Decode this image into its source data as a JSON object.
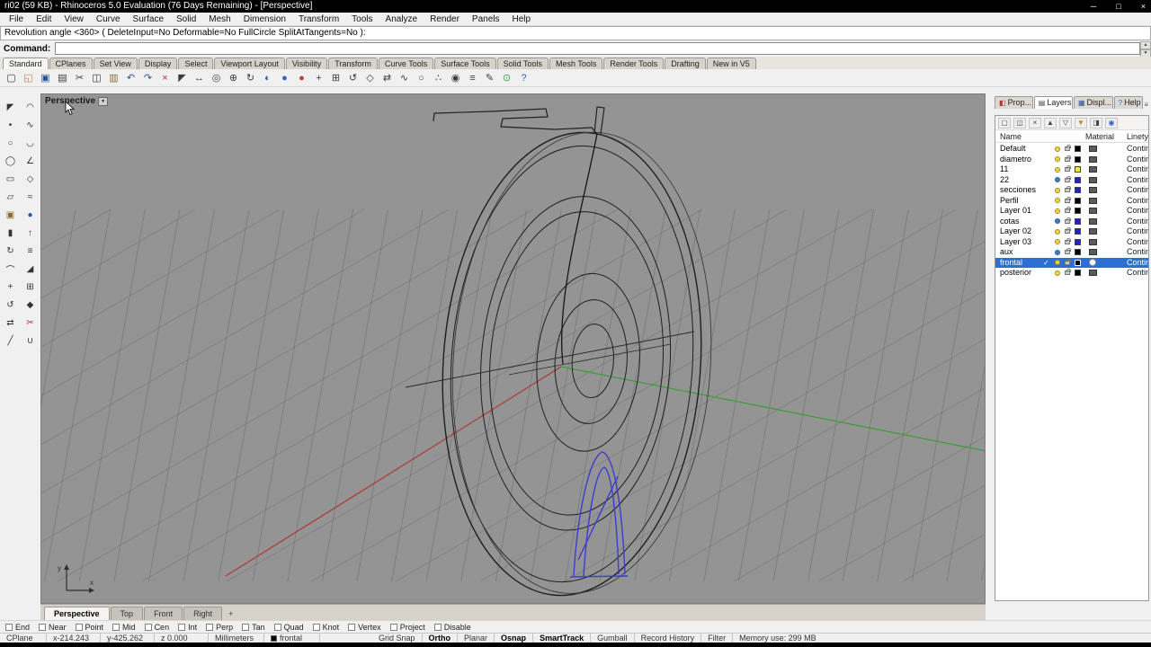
{
  "colors": {
    "selection_blue": "#2b6fd4",
    "axis_red": "#b03030",
    "axis_green": "#2f9e2f",
    "curve_blue": "#3b3bd1",
    "viewport_bg": "#949494"
  },
  "icons": {
    "check": "✓",
    "dropdown_arrow": "▼",
    "up_arrow": "▲",
    "down_arrow": "▼",
    "new_viewport_tab": "+",
    "panel_menu": "≡"
  },
  "window": {
    "title": "ri02 (59 KB) - Rhinoceros 5.0 Evaluation (76 Days Remaining) - [Perspective]",
    "minimize": "─",
    "maximize": "□",
    "close": "×"
  },
  "menu_items": [
    "File",
    "Edit",
    "View",
    "Curve",
    "Surface",
    "Solid",
    "Mesh",
    "Dimension",
    "Transform",
    "Tools",
    "Analyze",
    "Render",
    "Panels",
    "Help"
  ],
  "command": {
    "history": "Revolution angle <360> ( DeleteInput=No  Deformable=No  FullCircle  SplitAtTangents=No ):",
    "label": "Command:",
    "input_value": ""
  },
  "toolbar_tabs": [
    {
      "label": "Standard",
      "active": true
    },
    {
      "label": "CPlanes"
    },
    {
      "label": "Set View"
    },
    {
      "label": "Display"
    },
    {
      "label": "Select"
    },
    {
      "label": "Viewport Layout"
    },
    {
      "label": "Visibility"
    },
    {
      "label": "Transform"
    },
    {
      "label": "Curve Tools"
    },
    {
      "label": "Surface Tools"
    },
    {
      "label": "Solid Tools"
    },
    {
      "label": "Mesh Tools"
    },
    {
      "label": "Render Tools"
    },
    {
      "label": "Drafting"
    },
    {
      "label": "New in V5"
    }
  ],
  "toolbar_icons": [
    {
      "name": "new-file-icon",
      "glyph": "▢",
      "color": "#3c3c3c"
    },
    {
      "name": "open-file-icon",
      "glyph": "◱",
      "color": "#c08a1a"
    },
    {
      "name": "save-icon",
      "glyph": "▣",
      "color": "#2f5496"
    },
    {
      "name": "print-icon",
      "glyph": "▤",
      "color": "#3c3c3c"
    },
    {
      "name": "cut-icon",
      "glyph": "✂",
      "color": "#3c3c3c"
    },
    {
      "name": "copy-icon",
      "glyph": "◫",
      "color": "#3c3c3c"
    },
    {
      "name": "paste-icon",
      "glyph": "▥",
      "color": "#8a6b2c"
    },
    {
      "name": "undo-icon",
      "glyph": "↶",
      "color": "#2f5496"
    },
    {
      "name": "redo-icon",
      "glyph": "↷",
      "color": "#2f5496"
    },
    {
      "name": "delete-icon",
      "glyph": "×",
      "color": "#b03030"
    },
    {
      "name": "select-icon",
      "glyph": "◤",
      "color": "#3c3c3c"
    },
    {
      "name": "pan-view-icon",
      "glyph": "↔",
      "color": "#3c3c3c"
    },
    {
      "name": "zoom-window-icon",
      "glyph": "◎",
      "color": "#3c3c3c"
    },
    {
      "name": "zoom-extents-icon",
      "glyph": "⊕",
      "color": "#3c3c3c"
    },
    {
      "name": "rotate-view-icon",
      "glyph": "↻",
      "color": "#3c3c3c"
    },
    {
      "name": "shaded-view-icon",
      "glyph": "◐",
      "color": "#2f5496"
    },
    {
      "name": "render-icon",
      "glyph": "●",
      "color": "#2e62c9"
    },
    {
      "name": "record-history-icon",
      "glyph": "●",
      "color": "#c23b2e"
    },
    {
      "name": "move-icon",
      "glyph": "+",
      "color": "#3c3c3c"
    },
    {
      "name": "copy-object-icon",
      "glyph": "⊞",
      "color": "#3c3c3c"
    },
    {
      "name": "rotate-icon",
      "glyph": "↺",
      "color": "#3c3c3c"
    },
    {
      "name": "scale-icon",
      "glyph": "◇",
      "color": "#3c3c3c"
    },
    {
      "name": "mirror-icon",
      "glyph": "⇄",
      "color": "#3c3c3c"
    },
    {
      "name": "curve-tools-icon",
      "glyph": "∿",
      "color": "#3c3c3c"
    },
    {
      "name": "circle-icon",
      "glyph": "○",
      "color": "#3c3c3c"
    },
    {
      "name": "control-points-icon",
      "glyph": "∴",
      "color": "#3c3c3c"
    },
    {
      "name": "object-snap-icon",
      "glyph": "◉",
      "color": "#3c3c3c"
    },
    {
      "name": "layers-icon",
      "glyph": "≡",
      "color": "#3c3c3c"
    },
    {
      "name": "properties-icon",
      "glyph": "✎",
      "color": "#3c3c3c"
    },
    {
      "name": "gumball-icon",
      "glyph": "⊙",
      "color": "#2e9e4f"
    },
    {
      "name": "help-icon",
      "glyph": "?",
      "color": "#2e62c9"
    }
  ],
  "sidebar_tools": [
    {
      "name": "select-tool-icon",
      "glyph": "◤"
    },
    {
      "name": "lasso-select-icon",
      "glyph": "◠"
    },
    {
      "name": "point-tool-icon",
      "glyph": "•"
    },
    {
      "name": "curve-tool-icon",
      "glyph": "∿"
    },
    {
      "name": "circle-tool-icon",
      "glyph": "○"
    },
    {
      "name": "arc-tool-icon",
      "glyph": "◡"
    },
    {
      "name": "ellipse-tool-icon",
      "glyph": "◯"
    },
    {
      "name": "polyline-tool-icon",
      "glyph": "∠"
    },
    {
      "name": "rectangle-tool-icon",
      "glyph": "▭"
    },
    {
      "name": "polygon-tool-icon",
      "glyph": "◇"
    },
    {
      "name": "surface-tool-icon",
      "glyph": "▱"
    },
    {
      "name": "sweep-tool-icon",
      "glyph": "≈"
    },
    {
      "name": "box-tool-icon",
      "glyph": "▣",
      "color": "#8a6b2c"
    },
    {
      "name": "sphere-tool-icon",
      "glyph": "●",
      "color": "#2f5496"
    },
    {
      "name": "cylinder-tool-icon",
      "glyph": "▮"
    },
    {
      "name": "extrude-tool-icon",
      "glyph": "↑"
    },
    {
      "name": "revolve-tool-icon",
      "glyph": "↻"
    },
    {
      "name": "loft-tool-icon",
      "glyph": "≡"
    },
    {
      "name": "fillet-tool-icon",
      "glyph": "⌒"
    },
    {
      "name": "chamfer-tool-icon",
      "glyph": "◢"
    },
    {
      "name": "move-tool-icon",
      "glyph": "+"
    },
    {
      "name": "copy-tool-icon",
      "glyph": "⊞"
    },
    {
      "name": "rotate-tool-icon",
      "glyph": "↺"
    },
    {
      "name": "scale-tool-icon",
      "glyph": "◆"
    },
    {
      "name": "mirror-tool-icon",
      "glyph": "⇄"
    },
    {
      "name": "trim-tool-icon",
      "glyph": "✂",
      "color": "#b03030"
    },
    {
      "name": "split-tool-icon",
      "glyph": "╱"
    },
    {
      "name": "join-tool-icon",
      "glyph": "∪"
    }
  ],
  "viewport": {
    "label": "Perspective"
  },
  "viewport_tabs": [
    {
      "label": "Perspective",
      "active": true
    },
    {
      "label": "Top"
    },
    {
      "label": "Front"
    },
    {
      "label": "Right"
    }
  ],
  "right_panel": {
    "tabs": [
      {
        "label": "Prop...",
        "icon": "◧",
        "name": "tab-properties",
        "color": "#a33b3b"
      },
      {
        "label": "Layers",
        "icon": "▤",
        "name": "tab-layers",
        "active": true,
        "color": "#3c3c3c"
      },
      {
        "label": "Displ...",
        "icon": "▦",
        "name": "tab-display",
        "color": "#2f5496"
      },
      {
        "label": "Help",
        "icon": "?",
        "name": "tab-help",
        "color": "#2e62c9"
      }
    ],
    "toolbar": [
      {
        "name": "new-layer-icon",
        "glyph": "▢"
      },
      {
        "name": "new-sublayer-icon",
        "glyph": "◫"
      },
      {
        "name": "delete-layer-icon",
        "glyph": "×"
      },
      {
        "name": "move-up-icon",
        "glyph": "▲"
      },
      {
        "name": "expand-icon",
        "glyph": "▽"
      },
      {
        "name": "filter-icon",
        "glyph": "▼",
        "color": "#b58a1e"
      },
      {
        "name": "layer-tools-icon",
        "glyph": "◨"
      },
      {
        "name": "globe-icon",
        "glyph": "◉",
        "color": "#2e62c9"
      }
    ],
    "columns": [
      "Name",
      "Material",
      "Linetype"
    ],
    "layers": [
      {
        "name": "Default",
        "color": "#000000",
        "linetype": "Contin...",
        "selected": false,
        "current": false,
        "bulb_blue": false,
        "material_light": false
      },
      {
        "name": "diametro",
        "color": "#000000",
        "linetype": "Contin...",
        "selected": false,
        "current": false,
        "bulb_blue": false,
        "material_light": false
      },
      {
        "name": "11",
        "color": "#f5e642",
        "linetype": "Contin...",
        "selected": false,
        "current": false,
        "bulb_blue": false,
        "material_light": false
      },
      {
        "name": "22",
        "color": "#2222cc",
        "linetype": "Contin...",
        "selected": false,
        "current": false,
        "bulb_blue": true,
        "material_light": false
      },
      {
        "name": "secciones",
        "color": "#2222cc",
        "linetype": "Contin...",
        "selected": false,
        "current": false,
        "bulb_blue": false,
        "material_light": false
      },
      {
        "name": "Perfil",
        "color": "#000000",
        "linetype": "Contin...",
        "selected": false,
        "current": false,
        "bulb_blue": false,
        "material_light": false
      },
      {
        "name": "Layer 01",
        "color": "#000000",
        "linetype": "Contin...",
        "selected": false,
        "current": false,
        "bulb_blue": false,
        "material_light": false
      },
      {
        "name": "cotas",
        "color": "#2222cc",
        "linetype": "Contin...",
        "selected": false,
        "current": false,
        "bulb_blue": true,
        "material_light": false
      },
      {
        "name": "Layer 02",
        "color": "#2222cc",
        "linetype": "Contin...",
        "selected": false,
        "current": false,
        "bulb_blue": false,
        "material_light": false
      },
      {
        "name": "Layer 03",
        "color": "#2222cc",
        "linetype": "Contin...",
        "selected": false,
        "current": false,
        "bulb_blue": false,
        "material_light": false
      },
      {
        "name": "aux",
        "color": "#000000",
        "linetype": "Contin...",
        "selected": false,
        "current": false,
        "bulb_blue": true,
        "material_light": false
      },
      {
        "name": "frontal",
        "color": "#000000",
        "linetype": "Contin...",
        "selected": true,
        "current": true,
        "bulb_blue": false,
        "material_light": true
      },
      {
        "name": "posterior",
        "color": "#000000",
        "linetype": "Contin...",
        "selected": false,
        "current": false,
        "bulb_blue": false,
        "material_light": false
      }
    ]
  },
  "osnap": {
    "items": [
      {
        "label": "End",
        "checked": false
      },
      {
        "label": "Near",
        "checked": false
      },
      {
        "label": "Point",
        "checked": false
      },
      {
        "label": "Mid",
        "checked": false
      },
      {
        "label": "Cen",
        "checked": false
      },
      {
        "label": "Int",
        "checked": false
      },
      {
        "label": "Perp",
        "checked": false
      },
      {
        "label": "Tan",
        "checked": false
      },
      {
        "label": "Quad",
        "checked": false
      },
      {
        "label": "Knot",
        "checked": false
      },
      {
        "label": "Vertex",
        "checked": false
      },
      {
        "label": "Project",
        "checked": false
      },
      {
        "label": "Disable",
        "checked": false
      }
    ]
  },
  "status_bar": {
    "cplane": "CPlane",
    "coords": [
      {
        "label": "x-214.243"
      },
      {
        "label": "y-425.262"
      },
      {
        "label": "z 0.000"
      }
    ],
    "units": "Millimeters",
    "layer": "frontal",
    "toggles": [
      {
        "label": "Grid Snap",
        "on": false
      },
      {
        "label": "Ortho",
        "on": true
      },
      {
        "label": "Planar",
        "on": false
      },
      {
        "label": "Osnap",
        "on": true
      },
      {
        "label": "SmartTrack",
        "on": true
      },
      {
        "label": "Gumball",
        "on": false
      },
      {
        "label": "Record History",
        "on": false
      },
      {
        "label": "Filter",
        "on": false
      }
    ],
    "memory": "Memory use: 299 MB"
  }
}
